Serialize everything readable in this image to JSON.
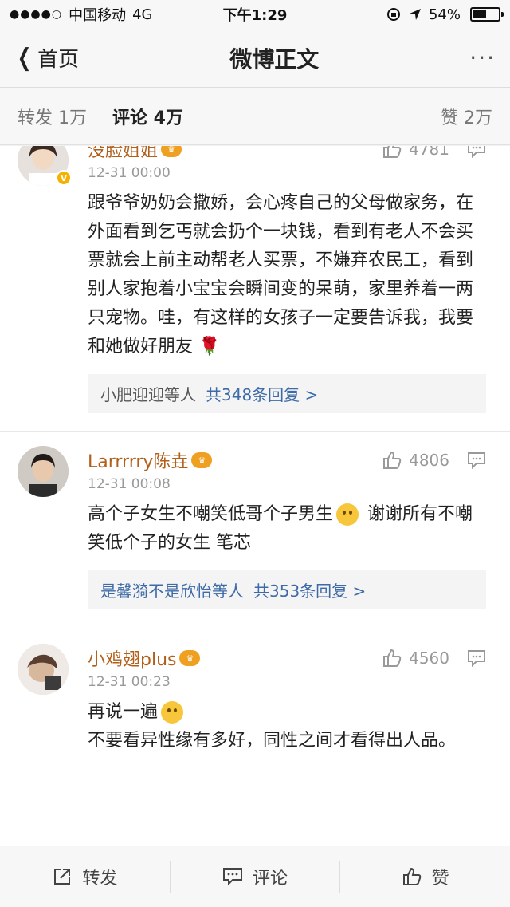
{
  "status_bar": {
    "signal": "●●●●○",
    "carrier": "中国移动",
    "network": "4G",
    "time": "下午1:29",
    "battery_text": "54%",
    "battery_level": 0.54
  },
  "nav": {
    "back_label": "首页",
    "title": "微博正文",
    "more": "···"
  },
  "tabs": {
    "repost": "转发 1万",
    "comment": "评论 4万",
    "like": "赞 2万"
  },
  "comments": [
    {
      "username": "没脸姐姐",
      "likes": "4781",
      "time": "12-31 00:00",
      "text": [
        "跟爷爷奶奶会撒娇，会心疼自己的父母做家务，在外面看到乞丐就会扔个一块钱，看到有老人不会买票就会上前主动帮老人买票，不嫌弃农民工，看到别人家抱着小宝宝会瞬间变的呆萌，家里养着一两只宠物。哇，有这样的女孩子一定要告诉我，我要和她做好朋友"
      ],
      "replies_users": "小肥迎迎等人",
      "replies_count": "共348条回复 >"
    },
    {
      "username": "Larrrrry陈垚",
      "likes": "4806",
      "time": "12-31 00:08",
      "text_before_emoji": "高个子女生不嘲笑低哥个子男生",
      "text_after_emoji": " 谢谢所有不嘲笑低个子的女生 笔芯",
      "replies_users": "是馨漪不是欣怡等人",
      "replies_count": "共353条回复 >"
    },
    {
      "username": "小鸡翅plus",
      "likes": "4560",
      "time": "12-31 00:23",
      "line1": "再说一遍",
      "line2": "不要看异性缘有多好，同性之间才看得出人品。"
    }
  ],
  "toolbar": {
    "repost": "转发",
    "comment": "评论",
    "like": "赞"
  }
}
